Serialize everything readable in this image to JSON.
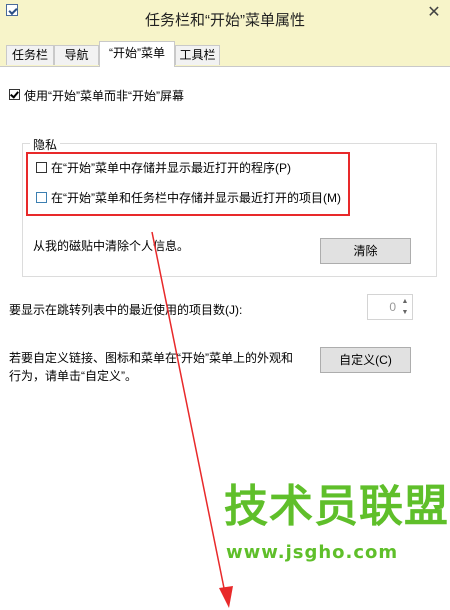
{
  "window": {
    "title": "任务栏和“开始”菜单属性",
    "close_glyph": "✕"
  },
  "tabs": [
    {
      "label": "任务栏",
      "active": false
    },
    {
      "label": "导航",
      "active": false
    },
    {
      "label": "“开始”菜单",
      "active": true
    },
    {
      "label": "工具栏",
      "active": false
    }
  ],
  "start_menu_option": {
    "label": "使用“开始”菜单而非“开始”屏幕",
    "checked": true
  },
  "privacy": {
    "group_title": "隐私",
    "store_recent_programs": {
      "label": "在“开始”菜单中存储并显示最近打开的程序(P)",
      "checked": false
    },
    "store_recent_items": {
      "label": "在“开始”菜单和任务栏中存储并显示最近打开的项目(M)",
      "checked": false
    },
    "clear_info_text": "从我的磁贴中清除个人信息。",
    "clear_button": "清除"
  },
  "jump_list": {
    "label": "要显示在跳转列表中的最近使用的项目数(J):",
    "value": "0",
    "up_glyph": "▲",
    "down_glyph": "▼"
  },
  "customize": {
    "text_line1": "若要自定义链接、图标和菜单在“开始”菜单上的外观和",
    "text_line2": "行为，请单击“自定义”。",
    "button": "自定义(C)"
  },
  "watermark": {
    "text": "技术员联盟",
    "url": "www.jsgho.com"
  },
  "colors": {
    "highlight": "#e8292a",
    "watermark": "#5fbf2a",
    "titlebar_bg": "#f7f4c9"
  }
}
